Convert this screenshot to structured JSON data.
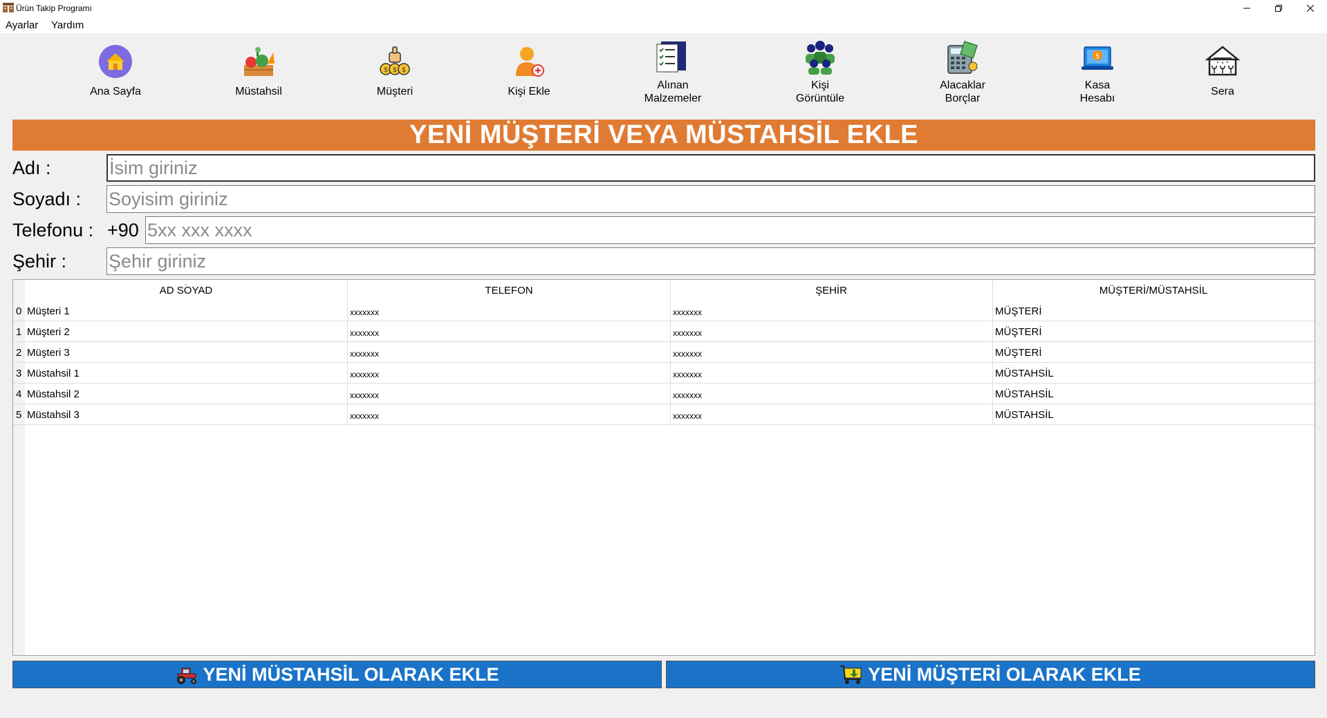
{
  "window": {
    "title": "Ürün Takip Programı",
    "minimize_icon": "minimize-icon",
    "restore_icon": "restore-icon",
    "close_icon": "close-icon"
  },
  "menu": {
    "items": [
      {
        "label": "Ayarlar"
      },
      {
        "label": "Yardım"
      }
    ]
  },
  "toolbar": {
    "items": [
      {
        "label1": "Ana Sayfa",
        "label2": "",
        "icon": "home-icon"
      },
      {
        "label1": "Müstahsil",
        "label2": "",
        "icon": "vegetables-icon"
      },
      {
        "label1": "Müşteri",
        "label2": "",
        "icon": "money-icon"
      },
      {
        "label1": "Kişi Ekle",
        "label2": "",
        "icon": "add-person-icon"
      },
      {
        "label1": "Alınan",
        "label2": "Malzemeler",
        "icon": "checklist-icon"
      },
      {
        "label1": "Kişi",
        "label2": "Görüntüle",
        "icon": "people-icon"
      },
      {
        "label1": "Alacaklar",
        "label2": "Borçlar",
        "icon": "calculator-icon"
      },
      {
        "label1": "Kasa",
        "label2": "Hesabı",
        "icon": "cash-laptop-icon"
      },
      {
        "label1": "Sera",
        "label2": "",
        "icon": "greenhouse-icon"
      }
    ]
  },
  "banner": {
    "title": "YENİ MÜŞTERİ VEYA MÜSTAHSİL EKLE",
    "color": "#e07b33"
  },
  "form": {
    "name_label": "Adı :",
    "name_placeholder": "İsim giriniz",
    "surname_label": "Soyadı :",
    "surname_placeholder": "Soyisim giriniz",
    "phone_label": "Telefonu :",
    "phone_prefix": "+90",
    "phone_placeholder": "5xx xxx xxxx",
    "city_label": "Şehir :",
    "city_placeholder": "Şehir giriniz"
  },
  "table": {
    "columns": [
      "AD SOYAD",
      "TELEFON",
      "ŞEHİR",
      "MÜŞTERİ/MÜSTAHSİL"
    ],
    "rows": [
      {
        "index": "0",
        "name": "Müşteri 1",
        "phone": "xxxxxxx",
        "city": "xxxxxxx",
        "type": "MÜŞTERİ"
      },
      {
        "index": "1",
        "name": "Müşteri 2",
        "phone": "xxxxxxx",
        "city": "xxxxxxx",
        "type": "MÜŞTERİ"
      },
      {
        "index": "2",
        "name": "Müşteri 3",
        "phone": "xxxxxxx",
        "city": "xxxxxxx",
        "type": "MÜŞTERİ"
      },
      {
        "index": "3",
        "name": "Müstahsil 1",
        "phone": "xxxxxxx",
        "city": "xxxxxxx",
        "type": "MÜSTAHSİL"
      },
      {
        "index": "4",
        "name": "Müstahsil 2",
        "phone": "xxxxxxx",
        "city": "xxxxxxx",
        "type": "MÜSTAHSİL"
      },
      {
        "index": "5",
        "name": "Müstahsil 3",
        "phone": "xxxxxxx",
        "city": "xxxxxxx",
        "type": "MÜSTAHSİL"
      }
    ]
  },
  "buttons": {
    "add_producer": {
      "label": "YENİ MÜSTAHSİL OLARAK EKLE",
      "icon": "tractor-icon"
    },
    "add_customer": {
      "label": "YENİ MÜŞTERİ OLARAK EKLE",
      "icon": "cart-icon"
    },
    "color": "#1a73c9"
  }
}
